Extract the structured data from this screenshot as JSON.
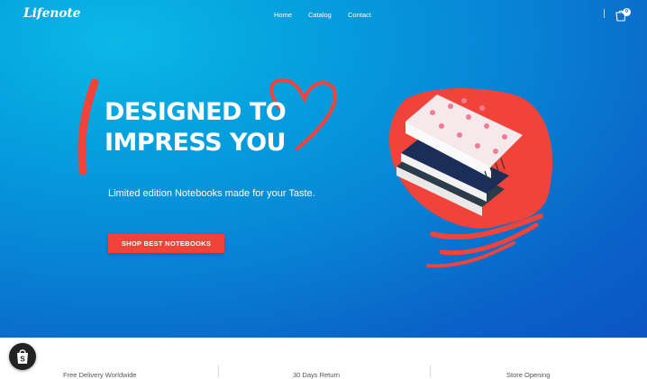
{
  "header": {
    "logo": "Lifenote",
    "nav": [
      {
        "label": "Home"
      },
      {
        "label": "Catalog"
      },
      {
        "label": "Contact"
      }
    ],
    "cart_count": "0"
  },
  "hero": {
    "headline_line1": "DESIGNED TO",
    "headline_line2": "IMPRESS YOU",
    "subtext": "Limited edition Notebooks made for your Taste.",
    "cta_label": "SHOP BEST NOTEBOOKS"
  },
  "features": [
    {
      "label": "Free Delivery Worldwide"
    },
    {
      "label": "30 Days Return"
    },
    {
      "label": "Store Opening"
    }
  ],
  "colors": {
    "hero_blue": "#0787d6",
    "accent_red": "#f0443b",
    "text_white": "#ffffff"
  }
}
